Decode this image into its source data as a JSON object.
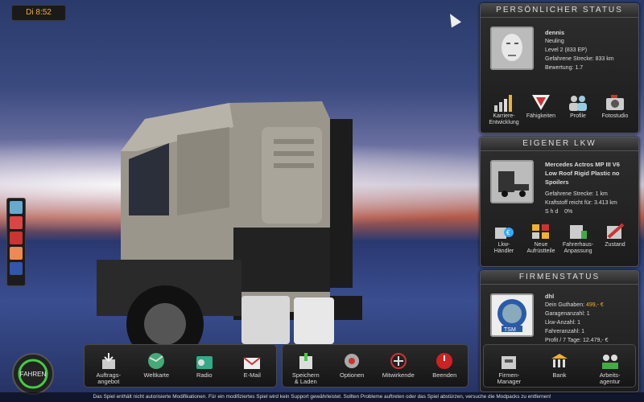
{
  "clock": "Di 8:52",
  "personal": {
    "title": "PERSÖNLICHER STATUS",
    "name": "dennis",
    "rank": "Neuling",
    "level": "Level 2 (833 EP)",
    "distance": "Gefahrene Strecke: 833 km",
    "rating": "Bewertung: 1.7",
    "buttons": [
      "Karriere-\nEntwicklung",
      "Fähigkeiten",
      "Profile",
      "Fotostudio"
    ]
  },
  "truck": {
    "title": "EIGENER LKW",
    "model": "Mercedes Actros MP III V6 Low Roof Rigid Plastic no Spoilers",
    "distance": "Gefahrene Strecke: 1 km",
    "fuel": "Kraftstoff reicht für: 3.413 km",
    "damage_label": "S h d",
    "damage_value": "0%",
    "buttons": [
      "Lkw-\nHändler",
      "Neue\nAufrüstteile",
      "Fahrerhaus-\nAnpassung",
      "Zustand"
    ]
  },
  "company": {
    "title": "FIRMENSTATUS",
    "name": "dhl",
    "balance_label": "Dein Guthaben:",
    "balance_value": "499,- €",
    "garages": "Garagenanzahl: 1",
    "trucks": "Lkw-Anzahl: 1",
    "drivers": "Fahreranzahl: 1",
    "profit": "Profit / 7 Tage: 12.479,- €",
    "logo_text": "TSM",
    "buttons": [
      "Firmen-\nManager",
      "Bank",
      "Arbeits-\nagentur"
    ]
  },
  "bottom": {
    "drive": "FAHREN",
    "group1": [
      "Auftrags-\nangebot",
      "Weltkarte",
      "Radio",
      "E-Mail"
    ],
    "group2": [
      "Speichern\n& Laden",
      "Optionen",
      "Mitwirkende",
      "Beenden"
    ]
  },
  "notice": "Das Spiel enthält nicht autorisierte Modifikationen. Für ein modifiziertes Spiel wird kein Support gewährleistet. Sollten Probleme auftreten oder das Spiel abstürzen, versuche die Modpacks zu entfernen!",
  "colors": {
    "accent": "#f0b030",
    "panel": "#222222"
  }
}
